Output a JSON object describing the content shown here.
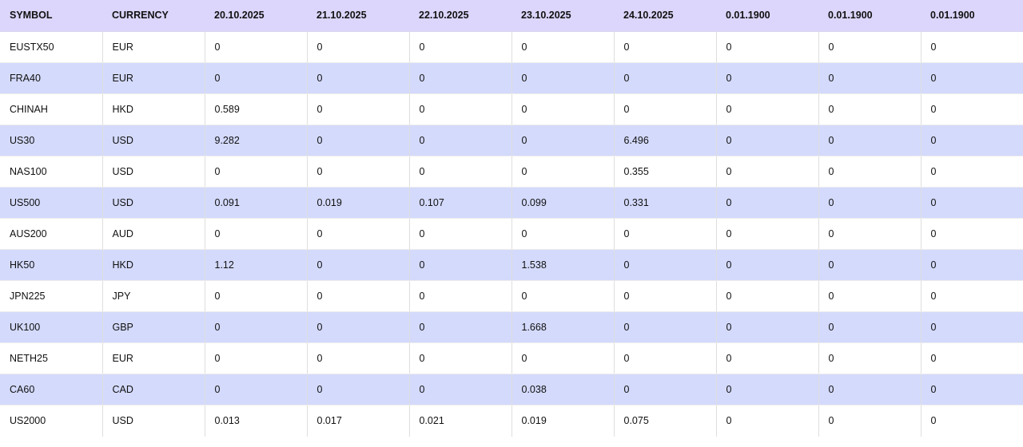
{
  "columns": [
    "SYMBOL",
    "CURRENCY",
    "20.10.2025",
    "21.10.2025",
    "22.10.2025",
    "23.10.2025",
    "24.10.2025",
    "0.01.1900",
    "0.01.1900",
    "0.01.1900"
  ],
  "rows": [
    [
      "EUSTX50",
      "EUR",
      "0",
      "0",
      "0",
      "0",
      "0",
      "0",
      "0",
      "0"
    ],
    [
      "FRA40",
      "EUR",
      "0",
      "0",
      "0",
      "0",
      "0",
      "0",
      "0",
      "0"
    ],
    [
      "CHINAH",
      "HKD",
      "0.589",
      "0",
      "0",
      "0",
      "0",
      "0",
      "0",
      "0"
    ],
    [
      "US30",
      "USD",
      "9.282",
      "0",
      "0",
      "0",
      "6.496",
      "0",
      "0",
      "0"
    ],
    [
      "NAS100",
      "USD",
      "0",
      "0",
      "0",
      "0",
      "0.355",
      "0",
      "0",
      "0"
    ],
    [
      "US500",
      "USD",
      "0.091",
      "0.019",
      "0.107",
      "0.099",
      "0.331",
      "0",
      "0",
      "0"
    ],
    [
      "AUS200",
      "AUD",
      "0",
      "0",
      "0",
      "0",
      "0",
      "0",
      "0",
      "0"
    ],
    [
      "HK50",
      "HKD",
      "1.12",
      "0",
      "0",
      "1.538",
      "0",
      "0",
      "0",
      "0"
    ],
    [
      "JPN225",
      "JPY",
      "0",
      "0",
      "0",
      "0",
      "0",
      "0",
      "0",
      "0"
    ],
    [
      "UK100",
      "GBP",
      "0",
      "0",
      "0",
      "1.668",
      "0",
      "0",
      "0",
      "0"
    ],
    [
      "NETH25",
      "EUR",
      "0",
      "0",
      "0",
      "0",
      "0",
      "0",
      "0",
      "0"
    ],
    [
      "CA60",
      "CAD",
      "0",
      "0",
      "0",
      "0.038",
      "0",
      "0",
      "0",
      "0"
    ],
    [
      "US2000",
      "USD",
      "0.013",
      "0.017",
      "0.021",
      "0.019",
      "0.075",
      "0",
      "0",
      "0"
    ]
  ],
  "colors": {
    "header_bg": "#ddd6fc",
    "stripe_bg": "#d4dafc",
    "row_bg": "#ffffff",
    "text": "#111111"
  }
}
